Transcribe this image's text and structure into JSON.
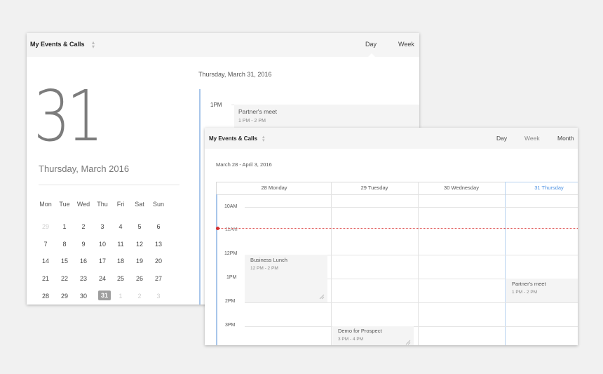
{
  "panel_day": {
    "title": "My Events & Calls",
    "views": [
      "Day",
      "Week"
    ],
    "big_date": "31",
    "date_sub": "Thursday, March 2016",
    "day_heading": "Thursday, March 31, 2016",
    "mini_calendar": {
      "weekdays": [
        "Mon",
        "Tue",
        "Wed",
        "Thu",
        "Fri",
        "Sat",
        "Sun"
      ],
      "weeks": [
        [
          "29",
          "1",
          "2",
          "3",
          "4",
          "5",
          "6"
        ],
        [
          "7",
          "8",
          "9",
          "10",
          "11",
          "12",
          "13"
        ],
        [
          "14",
          "15",
          "16",
          "17",
          "18",
          "19",
          "20"
        ],
        [
          "21",
          "22",
          "23",
          "24",
          "25",
          "26",
          "27"
        ],
        [
          "28",
          "29",
          "30",
          "31",
          "1",
          "2",
          "3"
        ]
      ],
      "selected": "31"
    },
    "hours": [
      "1PM"
    ],
    "event": {
      "title": "Partner's meet",
      "time": "1 PM - 2 PM"
    }
  },
  "panel_week": {
    "title": "My Events & Calls",
    "views": [
      "Day",
      "Week",
      "Month"
    ],
    "active_view": "Week",
    "range": "March 28 - April 3, 2016",
    "columns": [
      "28 Monday",
      "29 Tuesday",
      "30 Wednesday",
      "31 Thursday"
    ],
    "today_column": "31 Thursday",
    "hours": [
      "10AM",
      "11AM",
      "12PM",
      "1PM",
      "2PM",
      "3PM"
    ],
    "events": [
      {
        "title": "Business Lunch",
        "time": "12 PM - 2 PM",
        "day": "28 Monday"
      },
      {
        "title": "Partner's meet",
        "time": "1 PM - 2 PM",
        "day": "31 Thursday"
      },
      {
        "title": "Demo for Prospect",
        "time": "3 PM - 4 PM",
        "day": "29 Tuesday"
      }
    ]
  }
}
